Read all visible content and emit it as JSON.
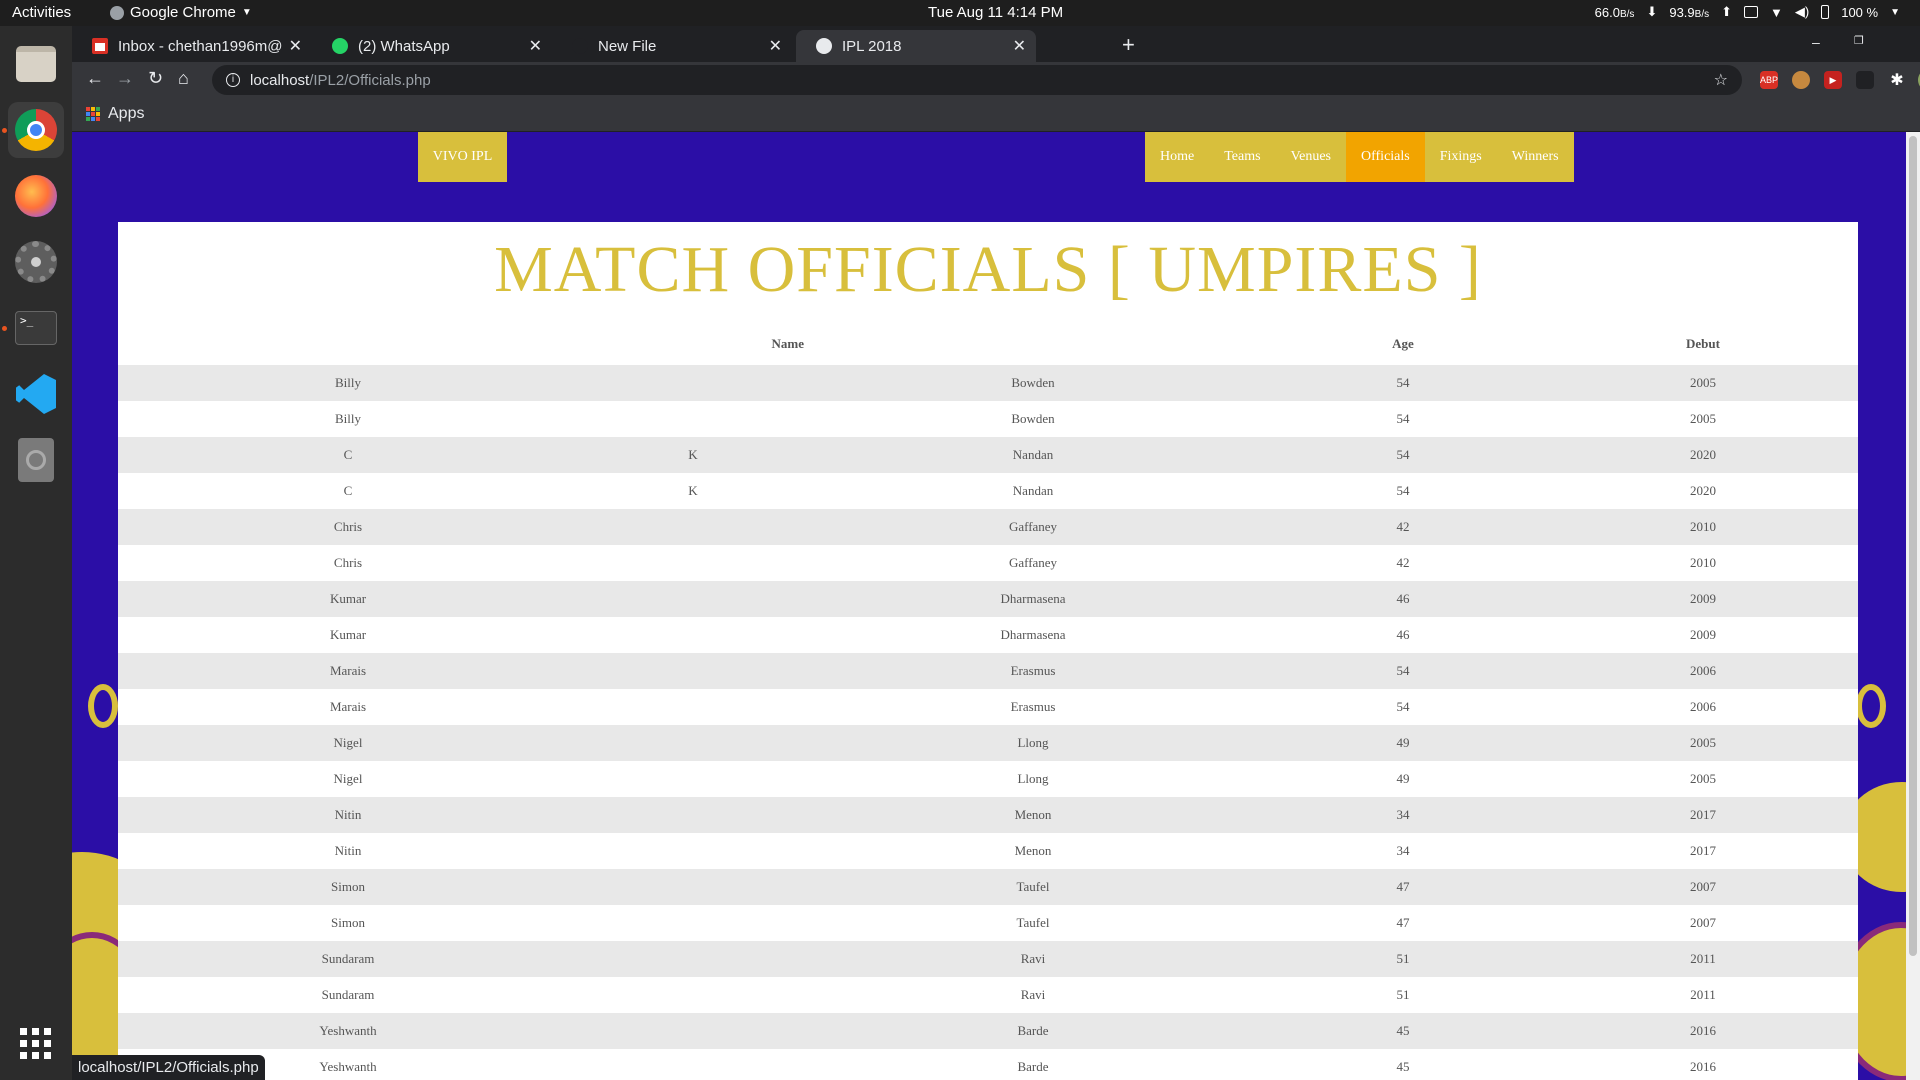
{
  "topbar": {
    "activities": "Activities",
    "app_name": "Google Chrome",
    "clock": "Tue Aug 11   4:14 PM",
    "net_down": "66.0",
    "net_down_unit": "B/s",
    "net_up": "93.9",
    "net_up_unit": "B/s",
    "battery": "100 %"
  },
  "tabs": [
    {
      "label": "Inbox - chethan1996m@",
      "icon": "gmail-icon"
    },
    {
      "label": "(2) WhatsApp",
      "icon": "whatsapp-icon"
    },
    {
      "label": "New File",
      "icon": "blank-page-icon"
    },
    {
      "label": "IPL 2018",
      "icon": "globe-icon"
    }
  ],
  "omnibox": {
    "host": "localhost",
    "path": "/IPL2/Officials.php"
  },
  "bookmarks": {
    "apps": "Apps"
  },
  "site": {
    "brand": "VIVO IPL",
    "nav": [
      "Home",
      "Teams",
      "Venues",
      "Officials",
      "Fixings",
      "Winners"
    ],
    "active_nav": "Officials",
    "heading": "MATCH OFFICIALS [ UMPIRES ]"
  },
  "table": {
    "headers": [
      "Name",
      "Age",
      "Debut"
    ],
    "rows": [
      [
        "Billy",
        "",
        "Bowden",
        "54",
        "2005"
      ],
      [
        "Billy",
        "",
        "Bowden",
        "54",
        "2005"
      ],
      [
        "C",
        "K",
        "Nandan",
        "54",
        "2020"
      ],
      [
        "C",
        "K",
        "Nandan",
        "54",
        "2020"
      ],
      [
        "Chris",
        "",
        "Gaffaney",
        "42",
        "2010"
      ],
      [
        "Chris",
        "",
        "Gaffaney",
        "42",
        "2010"
      ],
      [
        "Kumar",
        "",
        "Dharmasena",
        "46",
        "2009"
      ],
      [
        "Kumar",
        "",
        "Dharmasena",
        "46",
        "2009"
      ],
      [
        "Marais",
        "",
        "Erasmus",
        "54",
        "2006"
      ],
      [
        "Marais",
        "",
        "Erasmus",
        "54",
        "2006"
      ],
      [
        "Nigel",
        "",
        "Llong",
        "49",
        "2005"
      ],
      [
        "Nigel",
        "",
        "Llong",
        "49",
        "2005"
      ],
      [
        "Nitin",
        "",
        "Menon",
        "34",
        "2017"
      ],
      [
        "Nitin",
        "",
        "Menon",
        "34",
        "2017"
      ],
      [
        "Simon",
        "",
        "Taufel",
        "47",
        "2007"
      ],
      [
        "Simon",
        "",
        "Taufel",
        "47",
        "2007"
      ],
      [
        "Sundaram",
        "",
        "Ravi",
        "51",
        "2011"
      ],
      [
        "Sundaram",
        "",
        "Ravi",
        "51",
        "2011"
      ],
      [
        "Yeshwanth",
        "",
        "Barde",
        "45",
        "2016"
      ],
      [
        "Yeshwanth",
        "",
        "Barde",
        "45",
        "2016"
      ]
    ]
  },
  "statusbar": {
    "url": "localhost/IPL2/Officials.php"
  },
  "colors": {
    "page_bg": "#2b0ea6",
    "gold": "#d8bf3c",
    "nav_active": "#f2a400",
    "row_alt": "#e8e8e8"
  }
}
